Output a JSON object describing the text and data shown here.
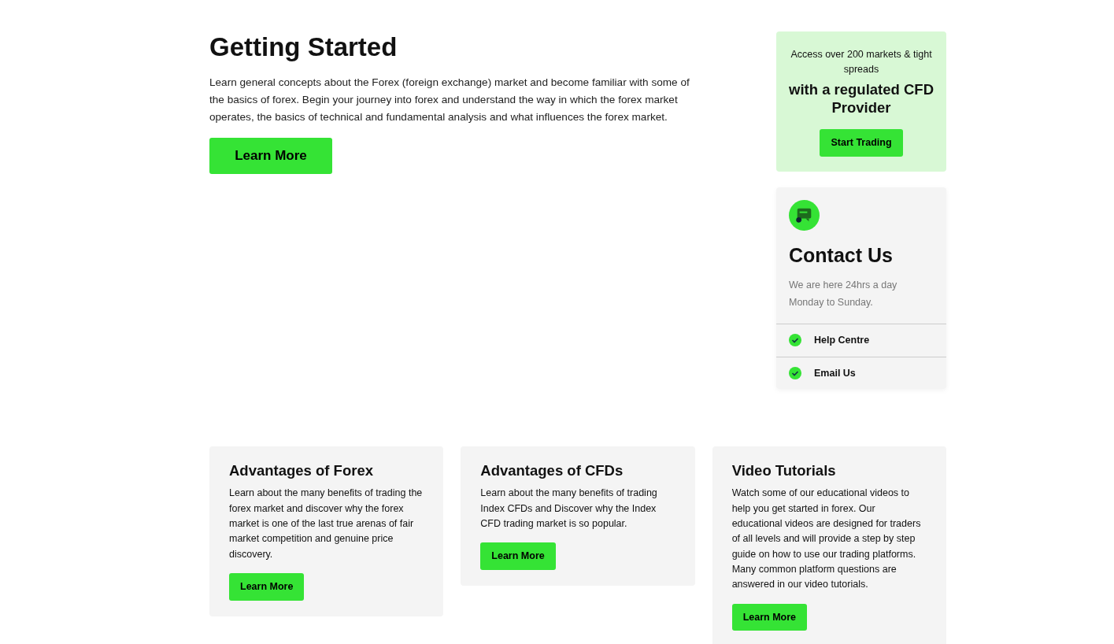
{
  "intro": {
    "title": "Getting Started",
    "text": "Learn general concepts about the Forex (foreign exchange) market and become familiar with some of the basics of forex. Begin your journey into forex and understand the way in which the forex market operates, the basics of technical and fundamental analysis and what influences the forex market.",
    "button": "Learn More"
  },
  "promo": {
    "lead": "Access over 200 markets & tight spreads",
    "headline": "with a regulated CFD Provider",
    "button": "Start Trading"
  },
  "contact": {
    "title": "Contact Us",
    "text": "We are here 24hrs a day Monday to Sunday.",
    "links": [
      {
        "label": "Help Centre"
      },
      {
        "label": "Email Us"
      }
    ]
  },
  "cards": [
    {
      "title": "Advantages of Forex",
      "text": "Learn about the many benefits of trading the forex market and discover why the forex market is one of the last true arenas of fair market competition and genuine price discovery.",
      "button": "Learn More"
    },
    {
      "title": "Advantages of CFDs",
      "text": "Learn about the many benefits of trading Index CFDs and Discover why the Index CFD trading market is so popular.",
      "button": "Learn More"
    },
    {
      "title": "Video Tutorials",
      "text": "Watch some of our educational videos to help you get started in forex. Our educational videos are designed for traders of all levels and will provide a step by step guide on how to use our trading platforms. Many common platform questions are answered in our video tutorials.",
      "button": "Learn More"
    }
  ]
}
